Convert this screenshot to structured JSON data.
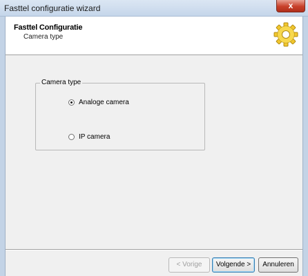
{
  "window": {
    "title": "Fasttel configuratie wizard",
    "close_symbol": "x"
  },
  "header": {
    "title": "Fasttel Configuratie",
    "subtitle": "Camera type",
    "icon": "gear-icon"
  },
  "group": {
    "legend": "Camera type",
    "options": [
      {
        "label": "Analoge camera",
        "selected": true
      },
      {
        "label": "IP camera",
        "selected": false
      }
    ]
  },
  "buttons": {
    "back_label": "< Vorige",
    "back_enabled": false,
    "next_label": "Volgende >",
    "cancel_label": "Annuleren"
  },
  "colors": {
    "titlebar": "#c5d6ea",
    "close": "#c8402a",
    "dialog": "#f0f0f0",
    "gear": "#f2c72e"
  }
}
